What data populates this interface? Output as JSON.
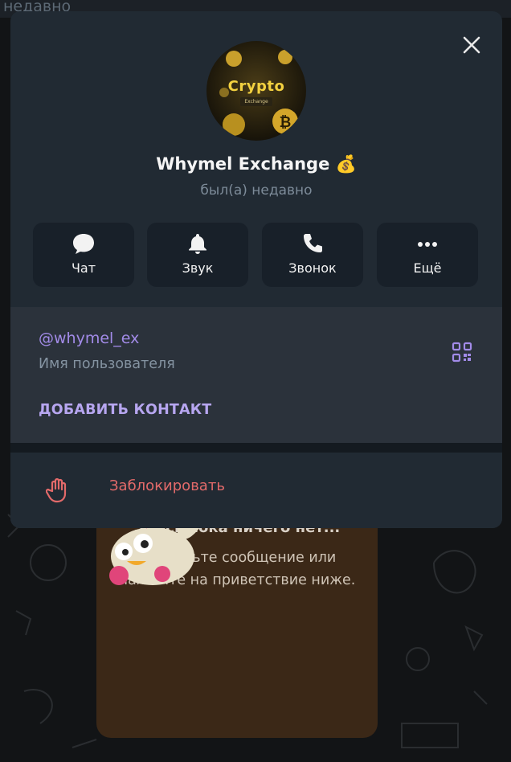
{
  "background": {
    "top_status": "недавно",
    "empty_chat": {
      "title": "Здесь пока ничего нет...",
      "text": "Отправьте сообщение или\nнажмите на приветствие ниже."
    }
  },
  "profile": {
    "avatar": {
      "title": "Crypto",
      "subtitle": "Exchange"
    },
    "name": "Whymel Exchange 💰",
    "status": "был(а) недавно"
  },
  "actions": [
    {
      "label": "Чат",
      "icon": "chat-bubble-icon"
    },
    {
      "label": "Звук",
      "icon": "bell-icon"
    },
    {
      "label": "Звонок",
      "icon": "phone-icon"
    },
    {
      "label": "Ещё",
      "icon": "more-dots-icon"
    }
  ],
  "info": {
    "username": "@whymel_ex",
    "username_caption": "Имя пользователя",
    "add_contact": "ДОБАВИТЬ КОНТАКТ"
  },
  "block": {
    "label": "Заблокировать"
  },
  "colors": {
    "modal_bg": "#212a33",
    "accent": "#a28be8",
    "danger": "#e36a6a"
  }
}
